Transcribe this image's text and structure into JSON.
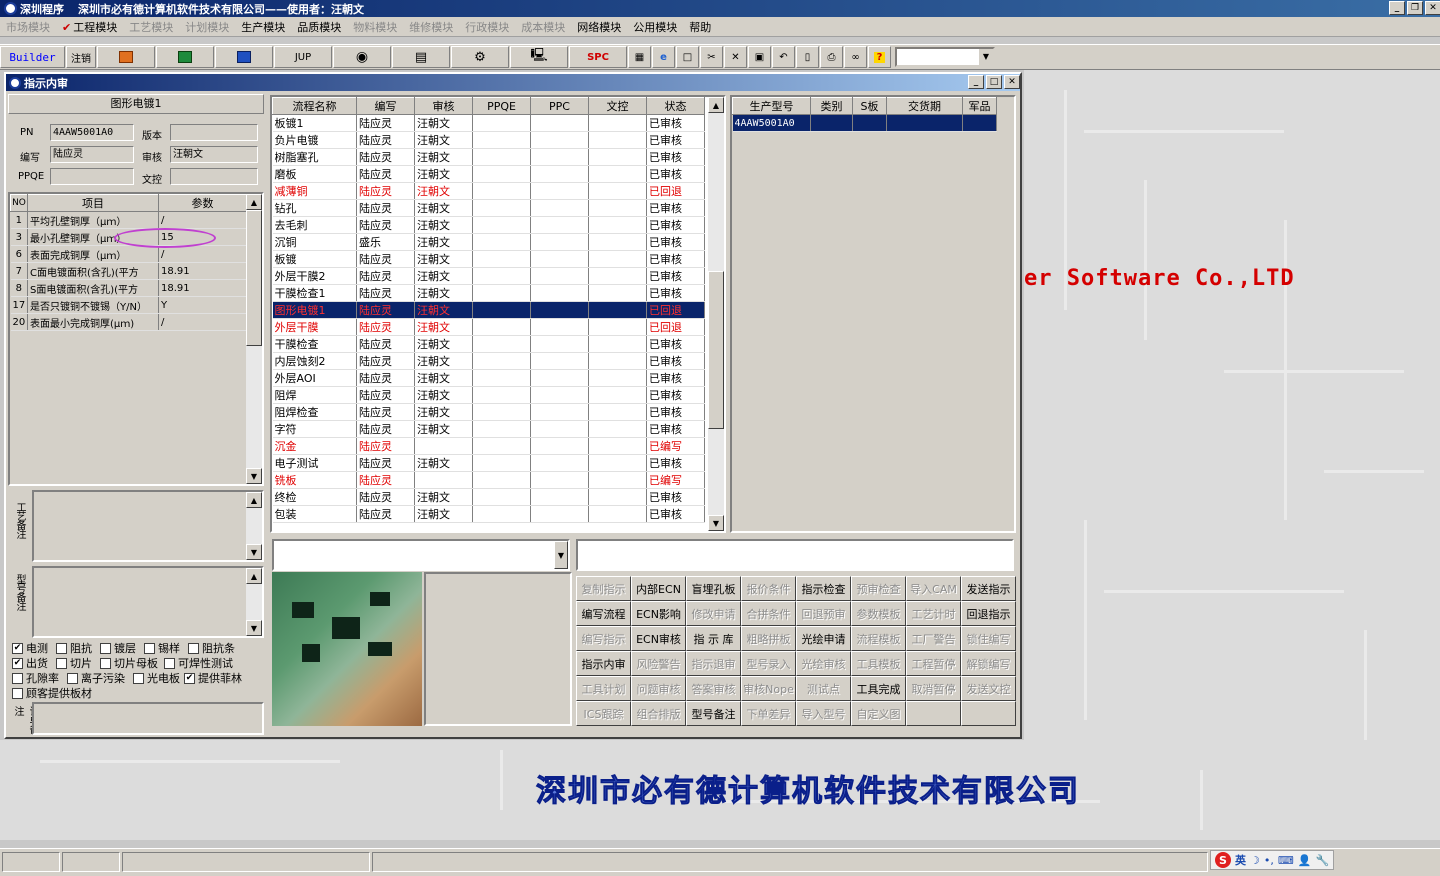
{
  "window": {
    "app_name": "深圳程序",
    "title": "深圳市必有德计算机软件技术有限公司——使用者：汪朝文"
  },
  "menu": [
    {
      "label": "市场模块",
      "enabled": false
    },
    {
      "label": "工程模块",
      "enabled": true,
      "checked": true
    },
    {
      "label": "工艺模块",
      "enabled": false
    },
    {
      "label": "计划模块",
      "enabled": false
    },
    {
      "label": "生产模块",
      "enabled": true
    },
    {
      "label": "品质模块",
      "enabled": true
    },
    {
      "label": "物料模块",
      "enabled": false
    },
    {
      "label": "维修模块",
      "enabled": false
    },
    {
      "label": "行政模块",
      "enabled": false
    },
    {
      "label": "成本模块",
      "enabled": false
    },
    {
      "label": "网络模块",
      "enabled": true
    },
    {
      "label": "公用模块",
      "enabled": true
    },
    {
      "label": "帮助",
      "enabled": true
    }
  ],
  "toolbar": {
    "builder": "Builder",
    "logout": "注销",
    "jup": "JUP",
    "spc": "SPC"
  },
  "child_window": {
    "title": "指示内审"
  },
  "left": {
    "instruction_name": "图形电镀1",
    "labels": {
      "pn": "PN",
      "version": "版本",
      "editor": "编写",
      "reviewer": "审核",
      "ppqe": "PPQE",
      "doc_control": "文控"
    },
    "values": {
      "pn": "4AAW5001A0",
      "version": "",
      "editor": "陆应灵",
      "reviewer": "汪朝文",
      "ppqe": "",
      "doc_control": ""
    },
    "param_grid": {
      "headers": [
        "NO",
        "项目",
        "参数"
      ],
      "rows": [
        {
          "no": "1",
          "item": "平均孔壁铜厚（μｍ）",
          "value": "/"
        },
        {
          "no": "3",
          "item": "最小孔壁铜厚（μｍ）",
          "value": "15"
        },
        {
          "no": "6",
          "item": "表面完成铜厚（μｍ）",
          "value": "/"
        },
        {
          "no": "7",
          "item": "C面电镀面积(含孔)(平方",
          "value": "18.91"
        },
        {
          "no": "8",
          "item": "S面电镀面积(含孔)(平方",
          "value": "18.91"
        },
        {
          "no": "17",
          "item": "是否只镀铜不镀锡（Y/N）",
          "value": "Y"
        },
        {
          "no": "20",
          "item": "表面最小完成铜厚(μｍ)",
          "value": "/"
        }
      ]
    },
    "craft_note_label": "工艺备注",
    "model_note_label": "型号备注",
    "order_note_label": "订单备注",
    "checkboxes": [
      [
        {
          "label": "电测",
          "checked": true
        },
        {
          "label": "阻抗",
          "checked": false
        },
        {
          "label": "镀层",
          "checked": false
        },
        {
          "label": "锡样",
          "checked": false
        },
        {
          "label": "阻抗条",
          "checked": false
        }
      ],
      [
        {
          "label": "出货",
          "checked": true
        },
        {
          "label": "切片",
          "checked": false
        },
        {
          "label": "切片母板",
          "checked": false
        },
        {
          "label": "可焊性测试",
          "checked": false
        }
      ],
      [
        {
          "label": "孔隙率",
          "checked": false
        },
        {
          "label": "离子污染",
          "checked": false
        },
        {
          "label": "光电板",
          "checked": false
        },
        {
          "label": "提供菲林",
          "checked": true
        }
      ],
      [
        {
          "label": "顾客提供板材",
          "checked": false
        }
      ]
    ]
  },
  "flow_grid": {
    "headers": [
      "流程名称",
      "编写",
      "审核",
      "PPQE",
      "PPC",
      "文控",
      "状态"
    ],
    "rows": [
      {
        "name": "板镀1",
        "editor": "陆应灵",
        "reviewer": "汪朝文",
        "status": "已审核",
        "style": "normal"
      },
      {
        "name": "负片电镀",
        "editor": "陆应灵",
        "reviewer": "汪朝文",
        "status": "已审核",
        "style": "normal"
      },
      {
        "name": "树脂塞孔",
        "editor": "陆应灵",
        "reviewer": "汪朝文",
        "status": "已审核",
        "style": "normal"
      },
      {
        "name": "磨板",
        "editor": "陆应灵",
        "reviewer": "汪朝文",
        "status": "已审核",
        "style": "normal"
      },
      {
        "name": "减薄铜",
        "editor": "陆应灵",
        "reviewer": "汪朝文",
        "status": "已回退",
        "style": "red"
      },
      {
        "name": "钻孔",
        "editor": "陆应灵",
        "reviewer": "汪朝文",
        "status": "已审核",
        "style": "normal"
      },
      {
        "name": "去毛刺",
        "editor": "陆应灵",
        "reviewer": "汪朝文",
        "status": "已审核",
        "style": "normal"
      },
      {
        "name": "沉铜",
        "editor": "盛乐",
        "reviewer": "汪朝文",
        "status": "已审核",
        "style": "normal"
      },
      {
        "name": "板镀",
        "editor": "陆应灵",
        "reviewer": "汪朝文",
        "status": "已审核",
        "style": "normal"
      },
      {
        "name": "外层干膜2",
        "editor": "陆应灵",
        "reviewer": "汪朝文",
        "status": "已审核",
        "style": "normal"
      },
      {
        "name": "干膜检查1",
        "editor": "陆应灵",
        "reviewer": "汪朝文",
        "status": "已审核",
        "style": "normal"
      },
      {
        "name": "图形电镀1",
        "editor": "陆应灵",
        "reviewer": "汪朝文",
        "status": "已回退",
        "style": "sel"
      },
      {
        "name": "外层干膜",
        "editor": "陆应灵",
        "reviewer": "汪朝文",
        "status": "已回退",
        "style": "red"
      },
      {
        "name": "干膜检查",
        "editor": "陆应灵",
        "reviewer": "汪朝文",
        "status": "已审核",
        "style": "normal"
      },
      {
        "name": "内层蚀刻2",
        "editor": "陆应灵",
        "reviewer": "汪朝文",
        "status": "已审核",
        "style": "normal"
      },
      {
        "name": "外层AOI",
        "editor": "陆应灵",
        "reviewer": "汪朝文",
        "status": "已审核",
        "style": "normal"
      },
      {
        "name": "阻焊",
        "editor": "陆应灵",
        "reviewer": "汪朝文",
        "status": "已审核",
        "style": "normal"
      },
      {
        "name": "阻焊检查",
        "editor": "陆应灵",
        "reviewer": "汪朝文",
        "status": "已审核",
        "style": "normal"
      },
      {
        "name": "字符",
        "editor": "陆应灵",
        "reviewer": "汪朝文",
        "status": "已审核",
        "style": "normal"
      },
      {
        "name": "沉金",
        "editor": "陆应灵",
        "reviewer": "",
        "status": "已编写",
        "style": "red"
      },
      {
        "name": "电子测试",
        "editor": "陆应灵",
        "reviewer": "汪朝文",
        "status": "已审核",
        "style": "normal"
      },
      {
        "name": "铣板",
        "editor": "陆应灵",
        "reviewer": "",
        "status": "已编写",
        "style": "red"
      },
      {
        "name": "终检",
        "editor": "陆应灵",
        "reviewer": "汪朝文",
        "status": "已审核",
        "style": "normal"
      },
      {
        "name": "包装",
        "editor": "陆应灵",
        "reviewer": "汪朝文",
        "status": "已审核",
        "style": "normal"
      }
    ]
  },
  "model_grid": {
    "headers": [
      "生产型号",
      "类别",
      "S板",
      "交货期",
      "军品"
    ],
    "rows": [
      {
        "model": "4AAW5001A0",
        "category": "",
        "s_board": "",
        "delivery": "",
        "military": ""
      }
    ]
  },
  "buttons": [
    [
      {
        "label": "复制指示",
        "enabled": false
      },
      {
        "label": "内部ECN",
        "enabled": true
      },
      {
        "label": "盲埋孔板",
        "enabled": true
      },
      {
        "label": "报价条件",
        "enabled": false
      },
      {
        "label": "指示检查",
        "enabled": true
      },
      {
        "label": "预审检查",
        "enabled": false
      },
      {
        "label": "导入CAM",
        "enabled": false
      },
      {
        "label": "发送指示",
        "enabled": true
      }
    ],
    [
      {
        "label": "编写流程",
        "enabled": true
      },
      {
        "label": "ECN影响",
        "enabled": true
      },
      {
        "label": "修改申请",
        "enabled": false
      },
      {
        "label": "合拼条件",
        "enabled": false
      },
      {
        "label": "回退预审",
        "enabled": false
      },
      {
        "label": "参数模板",
        "enabled": false
      },
      {
        "label": "工艺计时",
        "enabled": false
      },
      {
        "label": "回退指示",
        "enabled": true
      }
    ],
    [
      {
        "label": "编写指示",
        "enabled": false
      },
      {
        "label": "ECN审核",
        "enabled": true
      },
      {
        "label": "指 示 库",
        "enabled": true
      },
      {
        "label": "粗略拼板",
        "enabled": false
      },
      {
        "label": "光绘申请",
        "enabled": true
      },
      {
        "label": "流程模板",
        "enabled": false
      },
      {
        "label": "工厂警告",
        "enabled": false
      },
      {
        "label": "锁住编写",
        "enabled": false
      }
    ],
    [
      {
        "label": "指示内审",
        "enabled": true
      },
      {
        "label": "风险警告",
        "enabled": false
      },
      {
        "label": "指示退审",
        "enabled": false
      },
      {
        "label": "型号录入",
        "enabled": false
      },
      {
        "label": "光绘审核",
        "enabled": false
      },
      {
        "label": "工具模板",
        "enabled": false
      },
      {
        "label": "工程暂停",
        "enabled": false
      },
      {
        "label": "解锁编写",
        "enabled": false
      }
    ],
    [
      {
        "label": "工具计划",
        "enabled": false
      },
      {
        "label": "问题审核",
        "enabled": false
      },
      {
        "label": "答案审核",
        "enabled": false
      },
      {
        "label": "审核Nope",
        "enabled": false
      },
      {
        "label": "测试点",
        "enabled": false
      },
      {
        "label": "工具完成",
        "enabled": true
      },
      {
        "label": "取消暂停",
        "enabled": false
      },
      {
        "label": "发送文控",
        "enabled": false
      }
    ],
    [
      {
        "label": "ICS跟踪",
        "enabled": false
      },
      {
        "label": "组合排版",
        "enabled": false
      },
      {
        "label": "型号备注",
        "enabled": true
      },
      {
        "label": "下单差异",
        "enabled": false
      },
      {
        "label": "导入型号",
        "enabled": false
      },
      {
        "label": "自定义图",
        "enabled": false
      },
      {
        "label": "",
        "enabled": false
      },
      {
        "label": "",
        "enabled": false
      }
    ]
  ],
  "background": {
    "slogan_en": "er Software Co.,LTD",
    "company_cn": "深圳市必有德计算机软件技术有限公司"
  },
  "ime": {
    "lang": "英"
  }
}
